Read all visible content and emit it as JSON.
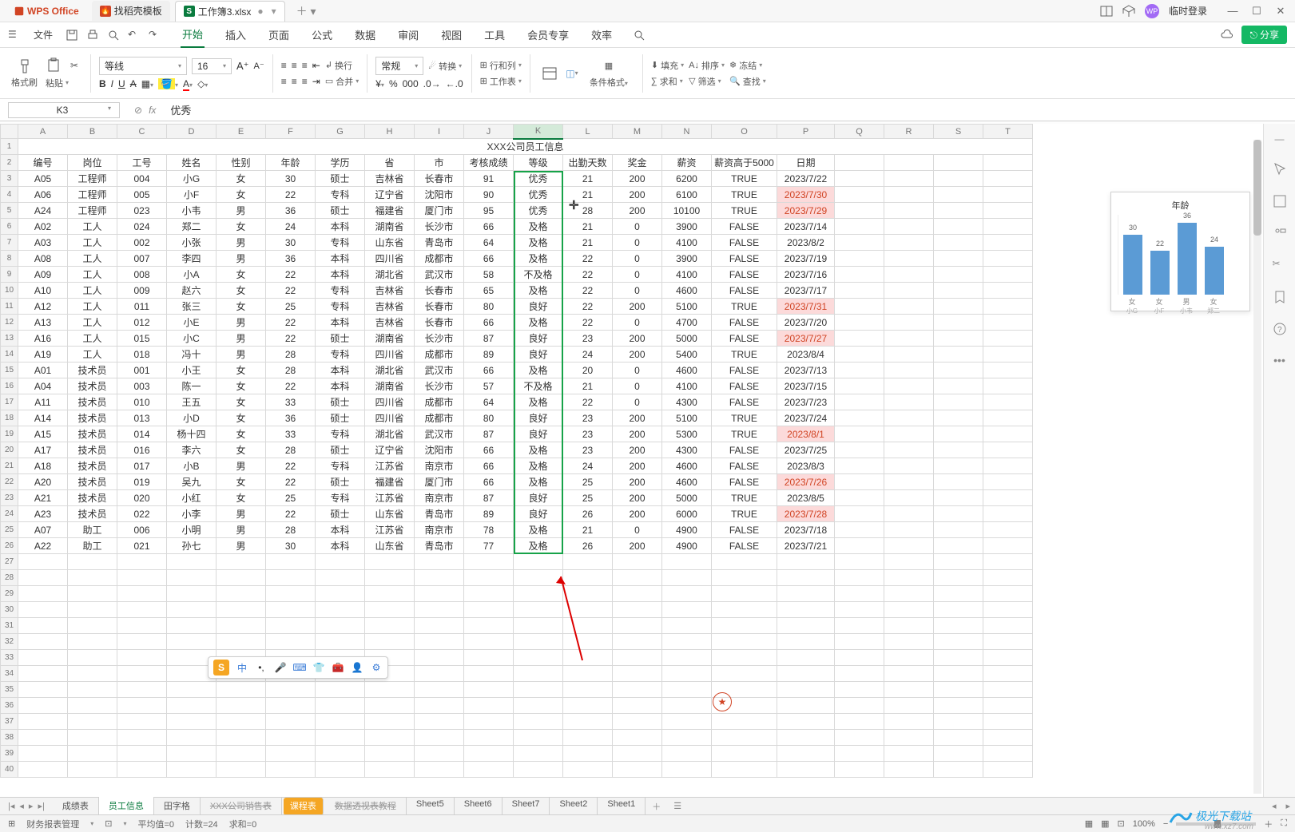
{
  "app": {
    "name": "WPS Office"
  },
  "tabs": {
    "template": "找稻壳模板",
    "active_doc": "工作簿3.xlsx",
    "template_icon": "S",
    "active_icon": "S"
  },
  "titlebar_right": {
    "login": "临时登录"
  },
  "menubar": {
    "file": "文件",
    "items": [
      "开始",
      "插入",
      "页面",
      "公式",
      "数据",
      "审阅",
      "视图",
      "工具",
      "会员专享",
      "效率"
    ],
    "share": "分享"
  },
  "ribbon": {
    "format_painter": "格式刷",
    "paste": "粘贴",
    "font_name": "等线",
    "font_size": "16",
    "wrap": "换行",
    "merge": "合并",
    "number_format": "常规",
    "convert": "转换",
    "row_col": "行和列",
    "worksheet": "工作表",
    "cond_format": "条件格式",
    "fill": "填充",
    "sum": "求和",
    "sort": "排序",
    "filter": "筛选",
    "freeze": "冻结",
    "find": "查找"
  },
  "formula_bar": {
    "cell": "K3",
    "value": "优秀"
  },
  "columns": [
    "A",
    "B",
    "C",
    "D",
    "E",
    "F",
    "G",
    "H",
    "I",
    "J",
    "K",
    "L",
    "M",
    "N",
    "O",
    "P",
    "Q",
    "R",
    "S",
    "T"
  ],
  "sheet_title": "XXX公司员工信息",
  "headers": [
    "编号",
    "岗位",
    "工号",
    "姓名",
    "性别",
    "年龄",
    "学历",
    "省",
    "市",
    "考核成绩",
    "等级",
    "出勤天数",
    "奖金",
    "薪资",
    "薪资高于5000",
    "日期"
  ],
  "rows": [
    [
      "A05",
      "工程师",
      "004",
      "小G",
      "女",
      "30",
      "硕士",
      "吉林省",
      "长春市",
      "91",
      "优秀",
      "21",
      "200",
      "6200",
      "TRUE",
      "2023/7/22",
      ""
    ],
    [
      "A06",
      "工程师",
      "005",
      "小F",
      "女",
      "22",
      "专科",
      "辽宁省",
      "沈阳市",
      "90",
      "优秀",
      "21",
      "200",
      "6100",
      "TRUE",
      "2023/7/30",
      "pink"
    ],
    [
      "A24",
      "工程师",
      "023",
      "小韦",
      "男",
      "36",
      "硕士",
      "福建省",
      "厦门市",
      "95",
      "优秀",
      "28",
      "200",
      "10100",
      "TRUE",
      "2023/7/29",
      "pink"
    ],
    [
      "A02",
      "工人",
      "024",
      "郑二",
      "女",
      "24",
      "本科",
      "湖南省",
      "长沙市",
      "66",
      "及格",
      "21",
      "0",
      "3900",
      "FALSE",
      "2023/7/14",
      ""
    ],
    [
      "A03",
      "工人",
      "002",
      "小张",
      "男",
      "30",
      "专科",
      "山东省",
      "青岛市",
      "64",
      "及格",
      "21",
      "0",
      "4100",
      "FALSE",
      "2023/8/2",
      ""
    ],
    [
      "A08",
      "工人",
      "007",
      "李四",
      "男",
      "36",
      "本科",
      "四川省",
      "成都市",
      "66",
      "及格",
      "22",
      "0",
      "3900",
      "FALSE",
      "2023/7/19",
      ""
    ],
    [
      "A09",
      "工人",
      "008",
      "小A",
      "女",
      "22",
      "本科",
      "湖北省",
      "武汉市",
      "58",
      "不及格",
      "22",
      "0",
      "4100",
      "FALSE",
      "2023/7/16",
      ""
    ],
    [
      "A10",
      "工人",
      "009",
      "赵六",
      "女",
      "22",
      "专科",
      "吉林省",
      "长春市",
      "65",
      "及格",
      "22",
      "0",
      "4600",
      "FALSE",
      "2023/7/17",
      ""
    ],
    [
      "A12",
      "工人",
      "011",
      "张三",
      "女",
      "25",
      "专科",
      "吉林省",
      "长春市",
      "80",
      "良好",
      "22",
      "200",
      "5100",
      "TRUE",
      "2023/7/31",
      "pink"
    ],
    [
      "A13",
      "工人",
      "012",
      "小E",
      "男",
      "22",
      "本科",
      "吉林省",
      "长春市",
      "66",
      "及格",
      "22",
      "0",
      "4700",
      "FALSE",
      "2023/7/20",
      ""
    ],
    [
      "A16",
      "工人",
      "015",
      "小C",
      "男",
      "22",
      "硕士",
      "湖南省",
      "长沙市",
      "87",
      "良好",
      "23",
      "200",
      "5000",
      "FALSE",
      "2023/7/27",
      "pink"
    ],
    [
      "A19",
      "工人",
      "018",
      "冯十",
      "男",
      "28",
      "专科",
      "四川省",
      "成都市",
      "89",
      "良好",
      "24",
      "200",
      "5400",
      "TRUE",
      "2023/8/4",
      ""
    ],
    [
      "A01",
      "技术员",
      "001",
      "小王",
      "女",
      "28",
      "本科",
      "湖北省",
      "武汉市",
      "66",
      "及格",
      "20",
      "0",
      "4600",
      "FALSE",
      "2023/7/13",
      ""
    ],
    [
      "A04",
      "技术员",
      "003",
      "陈一",
      "女",
      "22",
      "本科",
      "湖南省",
      "长沙市",
      "57",
      "不及格",
      "21",
      "0",
      "4100",
      "FALSE",
      "2023/7/15",
      ""
    ],
    [
      "A11",
      "技术员",
      "010",
      "王五",
      "女",
      "33",
      "硕士",
      "四川省",
      "成都市",
      "64",
      "及格",
      "22",
      "0",
      "4300",
      "FALSE",
      "2023/7/23",
      ""
    ],
    [
      "A14",
      "技术员",
      "013",
      "小D",
      "女",
      "36",
      "硕士",
      "四川省",
      "成都市",
      "80",
      "良好",
      "23",
      "200",
      "5100",
      "TRUE",
      "2023/7/24",
      ""
    ],
    [
      "A15",
      "技术员",
      "014",
      "杨十四",
      "女",
      "33",
      "专科",
      "湖北省",
      "武汉市",
      "87",
      "良好",
      "23",
      "200",
      "5300",
      "TRUE",
      "2023/8/1",
      "pink"
    ],
    [
      "A17",
      "技术员",
      "016",
      "李六",
      "女",
      "28",
      "硕士",
      "辽宁省",
      "沈阳市",
      "66",
      "及格",
      "23",
      "200",
      "4300",
      "FALSE",
      "2023/7/25",
      ""
    ],
    [
      "A18",
      "技术员",
      "017",
      "小B",
      "男",
      "22",
      "专科",
      "江苏省",
      "南京市",
      "66",
      "及格",
      "24",
      "200",
      "4600",
      "FALSE",
      "2023/8/3",
      ""
    ],
    [
      "A20",
      "技术员",
      "019",
      "吴九",
      "女",
      "22",
      "硕士",
      "福建省",
      "厦门市",
      "66",
      "及格",
      "25",
      "200",
      "4600",
      "FALSE",
      "2023/7/26",
      "pink"
    ],
    [
      "A21",
      "技术员",
      "020",
      "小红",
      "女",
      "25",
      "专科",
      "江苏省",
      "南京市",
      "87",
      "良好",
      "25",
      "200",
      "5000",
      "TRUE",
      "2023/8/5",
      ""
    ],
    [
      "A23",
      "技术员",
      "022",
      "小李",
      "男",
      "22",
      "硕士",
      "山东省",
      "青岛市",
      "89",
      "良好",
      "26",
      "200",
      "6000",
      "TRUE",
      "2023/7/28",
      "pink"
    ],
    [
      "A07",
      "助工",
      "006",
      "小明",
      "男",
      "28",
      "本科",
      "江苏省",
      "南京市",
      "78",
      "及格",
      "21",
      "0",
      "4900",
      "FALSE",
      "2023/7/18",
      ""
    ],
    [
      "A22",
      "助工",
      "021",
      "孙七",
      "男",
      "30",
      "本科",
      "山东省",
      "青岛市",
      "77",
      "及格",
      "26",
      "200",
      "4900",
      "FALSE",
      "2023/7/21",
      ""
    ]
  ],
  "chart_data": {
    "type": "bar",
    "title": "年龄",
    "categories": [
      "女",
      "女",
      "男",
      "女"
    ],
    "sub_categories": [
      "小G",
      "小F",
      "小韦",
      "郑二"
    ],
    "values": [
      30,
      22,
      36,
      24
    ],
    "ylim": [
      0,
      40
    ],
    "yticks": [
      0,
      5,
      10,
      15,
      20,
      25,
      30,
      35,
      40
    ]
  },
  "sheet_tabs": {
    "items": [
      "成绩表",
      "员工信息",
      "田字格",
      "XXX公司销售表",
      "课程表",
      "数据透视表教程",
      "Sheet5",
      "Sheet6",
      "Sheet7",
      "Sheet2",
      "Sheet1"
    ],
    "active": 1,
    "strike": [
      3,
      5
    ],
    "orange": [
      4
    ]
  },
  "statusbar": {
    "left_label": "财务报表管理",
    "avg": "平均值=0",
    "count": "计数=24",
    "sum": "求和=0",
    "zoom": "100%"
  },
  "watermark": "极光下载站"
}
